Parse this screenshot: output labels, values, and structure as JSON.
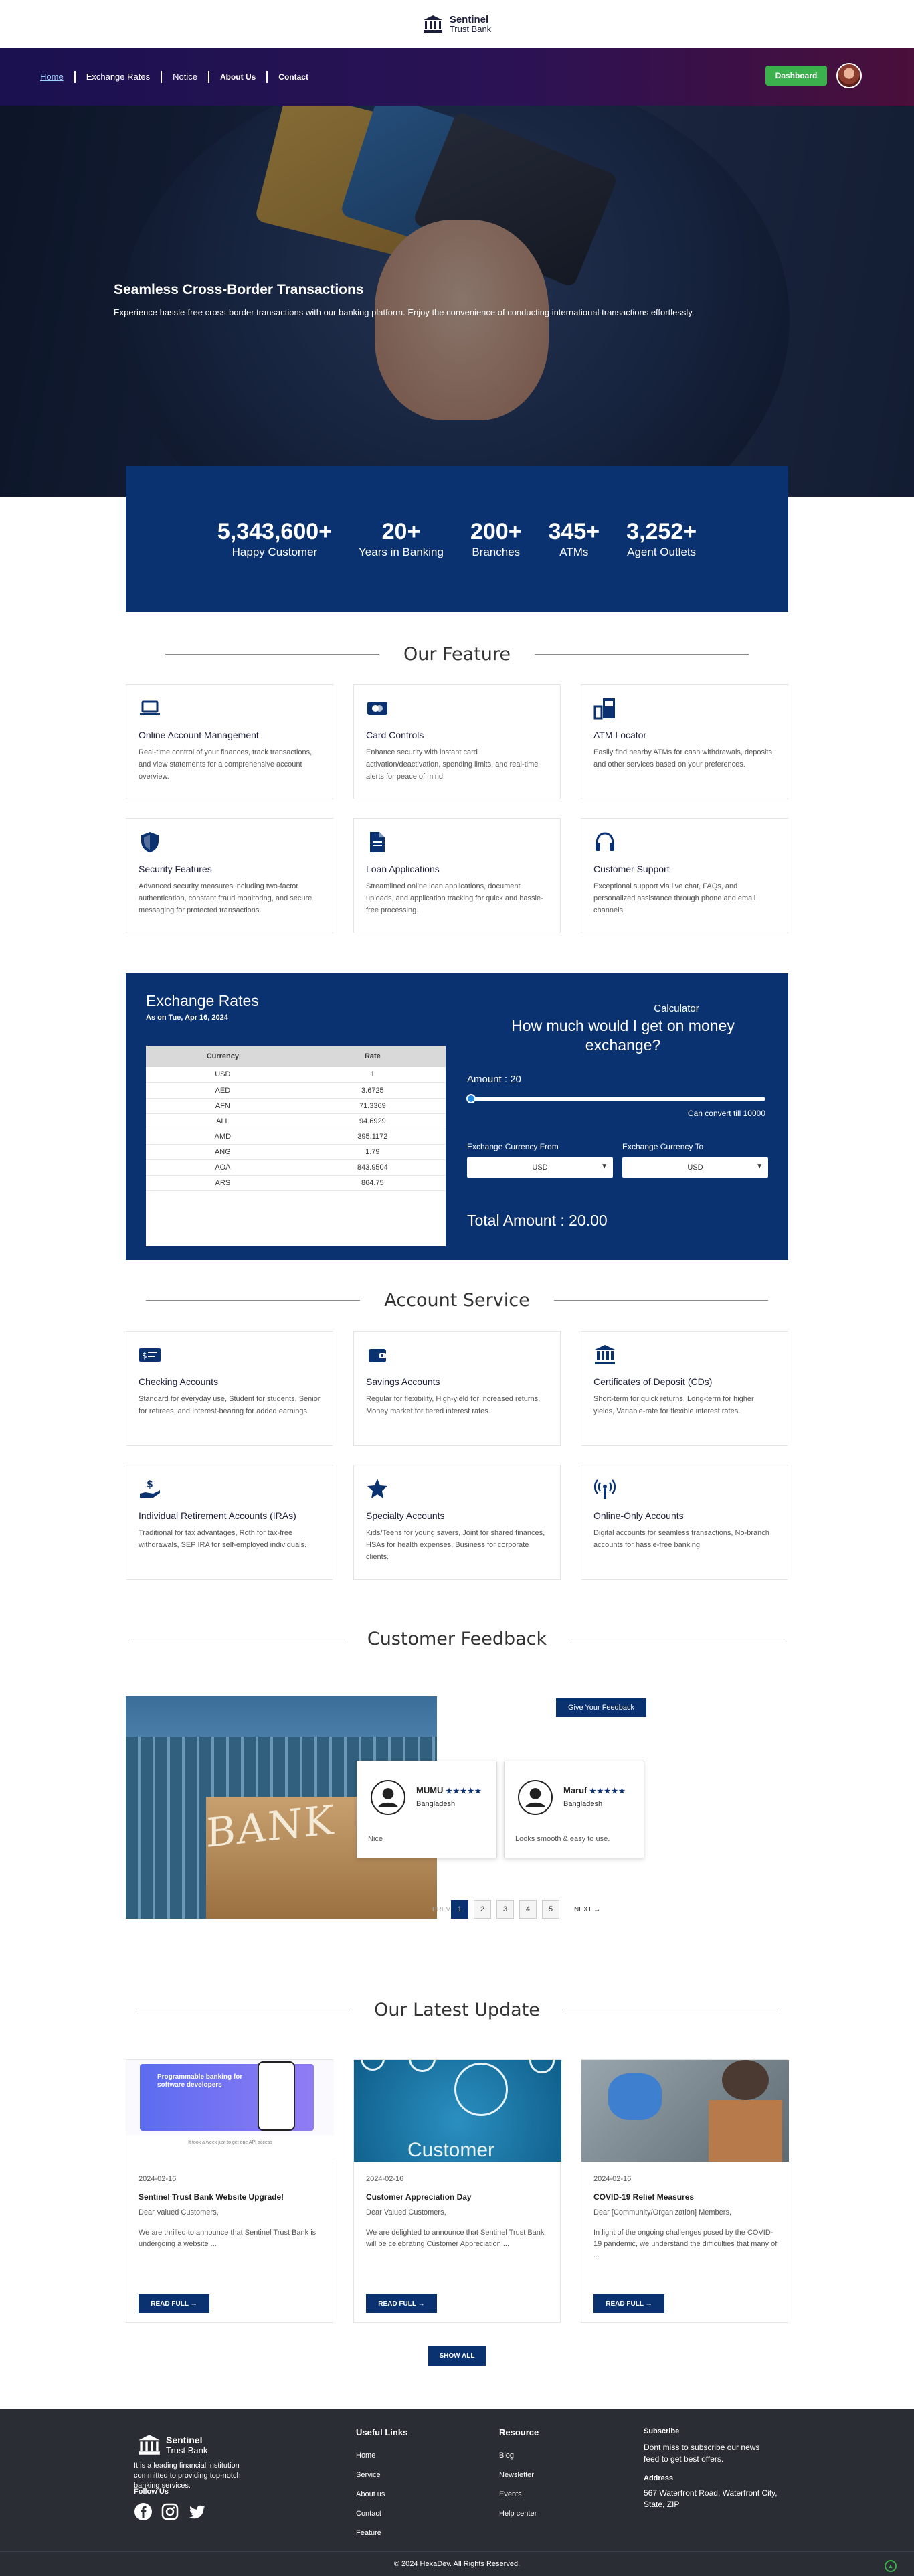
{
  "brand": {
    "name": "Sentinel",
    "sub": "Trust Bank"
  },
  "nav": {
    "items": [
      "Home",
      "Exchange Rates",
      "Notice",
      "About Us",
      "Contact"
    ],
    "dashboard": "Dashboard"
  },
  "hero": {
    "title": "Seamless Cross-Border Transactions",
    "subtitle": "Experience hassle-free cross-border transactions with our banking platform. Enjoy the convenience of conducting international transactions effortlessly."
  },
  "stats": [
    {
      "value": "5,343,600+",
      "label": "Happy Customer"
    },
    {
      "value": "20+",
      "label": "Years in Banking"
    },
    {
      "value": "200+",
      "label": "Branches"
    },
    {
      "value": "345+",
      "label": "ATMs"
    },
    {
      "value": "3,252+",
      "label": "Agent Outlets"
    }
  ],
  "features": {
    "heading": "Our Feature",
    "items": [
      {
        "icon": "laptop-icon",
        "title": "Online Account Management",
        "desc": "Real-time control of your finances, track transactions, and view statements for a comprehensive account overview."
      },
      {
        "icon": "card-icon",
        "title": "Card Controls",
        "desc": "Enhance security with instant card activation/deactivation, spending limits, and real-time alerts for peace of mind."
      },
      {
        "icon": "atm-icon",
        "title": "ATM Locator",
        "desc": "Easily find nearby ATMs for cash withdrawals, deposits, and other services based on your preferences."
      },
      {
        "icon": "shield-icon",
        "title": "Security Features",
        "desc": "Advanced security measures including two-factor authentication, constant fraud monitoring, and secure messaging for protected transactions."
      },
      {
        "icon": "document-icon",
        "title": "Loan Applications",
        "desc": "Streamlined online loan applications, document uploads, and application tracking for quick and hassle-free processing."
      },
      {
        "icon": "headset-icon",
        "title": "Customer Support",
        "desc": "Exceptional support via live chat, FAQs, and personalized assistance through phone and email channels."
      }
    ]
  },
  "exchange": {
    "title": "Exchange Rates",
    "date": "As on Tue, Apr 16, 2024",
    "headers": [
      "Currency",
      "Rate"
    ],
    "rows": [
      [
        "USD",
        "1"
      ],
      [
        "AED",
        "3.6725"
      ],
      [
        "AFN",
        "71.3369"
      ],
      [
        "ALL",
        "94.6929"
      ],
      [
        "AMD",
        "395.1172"
      ],
      [
        "ANG",
        "1.79"
      ],
      [
        "AOA",
        "843.9504"
      ],
      [
        "ARS",
        "864.75"
      ]
    ]
  },
  "calculator": {
    "label": "Calculator",
    "question": "How much would I get on money exchange?",
    "amount": "Amount : 20",
    "amount_fraction": 0.002,
    "limit": "Can convert till 10000",
    "from_label": "Exchange Currency From",
    "to_label": "Exchange Currency To",
    "from": "USD",
    "to": "USD",
    "total": "Total Amount : 20.00"
  },
  "accounts": {
    "heading": "Account Service",
    "items": [
      {
        "icon": "cheque-icon",
        "title": "Checking Accounts",
        "desc": "Standard for everyday use, Student for students, Senior for retirees, and Interest-bearing for added earnings."
      },
      {
        "icon": "wallet-icon",
        "title": "Savings Accounts",
        "desc": "Regular for flexibility, High-yield for increased returns, Money market for tiered interest rates."
      },
      {
        "icon": "bank-icon",
        "title": "Certificates of Deposit (CDs)",
        "desc": "Short-term for quick returns, Long-term for higher yields, Variable-rate for flexible interest rates."
      },
      {
        "icon": "hand-dollar-icon",
        "title": "Individual Retirement Accounts (IRAs)",
        "desc": "Traditional for tax advantages, Roth for tax-free withdrawals, SEP IRA for self-employed individuals."
      },
      {
        "icon": "star-badge-icon",
        "title": "Specialty Accounts",
        "desc": "Kids/Teens for young savers, Joint for shared finances, HSAs for health expenses, Business for corporate clients."
      },
      {
        "icon": "signal-icon",
        "title": "Online-Only Accounts",
        "desc": "Digital accounts for seamless transactions, No-branch accounts for hassle-free banking."
      }
    ]
  },
  "feedback": {
    "heading": "Customer Feedback",
    "button": "Give Your Feedback",
    "image_text": "BANK",
    "reviews": [
      {
        "name": "MUMU",
        "stars": "★★★★★",
        "location": "Bangladesh",
        "comment": "Nice"
      },
      {
        "name": "Maruf",
        "stars": "★★★★★",
        "location": "Bangladesh",
        "comment": "Looks smooth & easy to use."
      }
    ],
    "prev": "PREV",
    "pages": [
      "1",
      "2",
      "3",
      "4",
      "5"
    ],
    "next": "NEXT"
  },
  "updates": {
    "heading": "Our Latest Update",
    "read_more": "READ FULL",
    "show_all": "SHOW ALL",
    "items": [
      {
        "date": "2024-02-16",
        "title": "Sentinel Trust Bank Website Upgrade!",
        "greeting": "Dear Valued Customers,",
        "excerpt": "We are thrilled to announce that Sentinel Trust Bank is undergoing a website ...",
        "img_title": "Programmable banking for software developers",
        "img_caption": "It took a week just to get one API access"
      },
      {
        "date": "2024-02-16",
        "title": "Customer Appreciation Day",
        "greeting": "Dear Valued Customers,",
        "excerpt": "We are delighted to announce that Sentinel Trust Bank will be celebrating Customer Appreciation ...",
        "img_title": "Customer"
      },
      {
        "date": "2024-02-16",
        "title": "COVID-19 Relief Measures",
        "greeting": "Dear [Community/Organization] Members,",
        "excerpt": "In light of the ongoing challenges posed by the COVID-19 pandemic, we understand the difficulties that many of ..."
      }
    ]
  },
  "footer": {
    "about": "It is a leading financial institution committed to providing top-notch banking services.",
    "follow": "Follow Us",
    "useful_heading": "Useful Links",
    "useful": [
      "Home",
      "Service",
      "About us",
      "Contact",
      "Feature"
    ],
    "resource_heading": "Resource",
    "resource": [
      "Blog",
      "Newsletter",
      "Events",
      "Help center"
    ],
    "subscribe_heading": "Subscribe",
    "subscribe_text": "Dont miss to subscribe our news feed to get best offers.",
    "address_heading": "Address",
    "address": "567 Waterfront Road, Waterfront City, State, ZIP",
    "copyright": "© 2024 HexaDev. All Rights Reserved."
  },
  "colors": {
    "primary": "#0b3270",
    "accent": "#3cb04c",
    "footer": "#2a2d33"
  }
}
